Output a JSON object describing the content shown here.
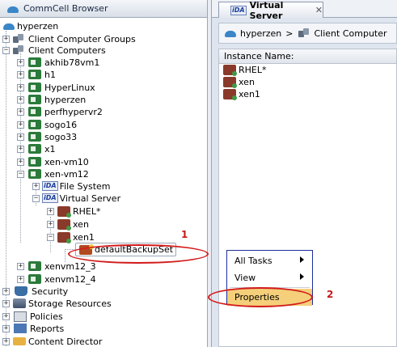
{
  "left_pane": {
    "title": "CommCell Browser",
    "tree": {
      "root": "hyperzen",
      "client_computer_groups": "Client Computer Groups",
      "client_computers": "Client Computers",
      "clients": [
        "akhib78vm1",
        "h1",
        "HyperLinux",
        "hyperzen",
        "perfhypervr2",
        "sogo16",
        "sogo33",
        "x1",
        "xen-vm10"
      ],
      "expanded_client": "xen-vm12",
      "file_system": "File System",
      "virtual_server": "Virtual Server",
      "instances": [
        "RHEL*",
        "xen",
        "xen1"
      ],
      "backup_set": "defaultBackupSet",
      "clients_after": [
        "xenvm12_3",
        "xenvm12_4"
      ],
      "security": "Security",
      "storage_resources": "Storage Resources",
      "policies": "Policies",
      "reports": "Reports",
      "content_director": "Content Director"
    }
  },
  "right_pane": {
    "tab_label": "Virtual Server",
    "tab_icon_text": "iDA",
    "breadcrumb": {
      "root": "hyperzen",
      "separator": ">",
      "next": "Client Computer"
    },
    "column_header": "Instance Name:",
    "instances": [
      "RHEL*",
      "xen",
      "xen1"
    ]
  },
  "context_menu": {
    "items": [
      "All Tasks",
      "View",
      "Properties"
    ],
    "highlighted": "Properties"
  },
  "callouts": [
    "1",
    "2"
  ],
  "icons": {
    "ida_text": "iDA",
    "expand_plus": "+",
    "expand_minus": "−"
  },
  "colors": {
    "callout_red": "#d21a1a",
    "menu_highlight": "#f5cf7a",
    "menu_border": "#1c2d9c"
  }
}
